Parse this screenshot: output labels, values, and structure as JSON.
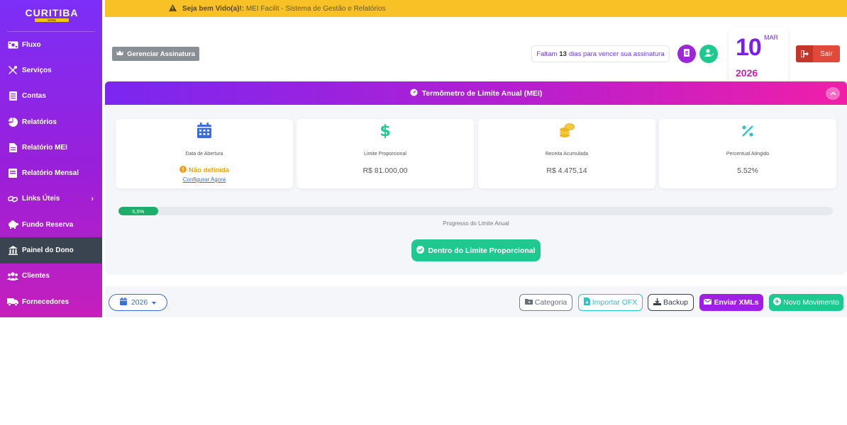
{
  "sidebar": {
    "logo_text": "CURITIBA",
    "logo_subtext": "SITES",
    "items": [
      {
        "label": "Fluxo",
        "icon": "money-bill-icon"
      },
      {
        "label": "Serviços",
        "icon": "tools-icon"
      },
      {
        "label": "Contas",
        "icon": "document-icon"
      },
      {
        "label": "Relatórios",
        "icon": "pie-chart-icon"
      },
      {
        "label": "Relatório MEI",
        "icon": "file-icon"
      },
      {
        "label": "Relatório Mensal",
        "icon": "book-icon"
      },
      {
        "label": "Links Úteis",
        "icon": "link-icon"
      },
      {
        "label": "Fundo Reserva",
        "icon": "piggy-bank-icon"
      },
      {
        "label": "Painel do Dono",
        "icon": "bank-icon"
      },
      {
        "label": "Clientes",
        "icon": "users-icon"
      },
      {
        "label": "Fornecedores",
        "icon": "truck-icon"
      }
    ],
    "active_item": "Painel do Dono"
  },
  "topbar": {
    "greeting": "Seja bem Vido(a)!:",
    "message": "MEI Facilit - Sistema de Gestão e Relatórios"
  },
  "header": {
    "gerenciar_label": "Gerenciar Assinatura",
    "faltam_prefix": "Faltam",
    "faltam_days": "13",
    "faltam_suffix": "dias para vencer sua assinatura",
    "date_day": "10",
    "date_month": "MAR",
    "date_year": "2026",
    "sair_label": "Sair"
  },
  "thermometer": {
    "title": "Termômetro de Limite Anual (MEI)",
    "cards": {
      "abertura": {
        "label": "Data de Abertura",
        "status": "Não definida",
        "link": "Configurar Agora"
      },
      "limite": {
        "label": "Limite Proporcional",
        "value": "R$ 81.000,00"
      },
      "receita": {
        "label": "Receita Acumulada",
        "value": "R$ 4.475,14"
      },
      "percentual": {
        "label": "Percentual Atingido",
        "value": "5.52%"
      }
    },
    "progress_label": "5,5%",
    "progress_value": 5.52,
    "progress_caption": "Progresso do Limite Anual",
    "status_label": "Dentro do Limite Proporcional"
  },
  "toolbar": {
    "year": "2026",
    "categoria": "Categoria",
    "importar_ofx": "Importar OFX",
    "backup": "Backup",
    "enviar_xmls": "Enviar XMLs",
    "novo_movimento": "Novo Movimento"
  },
  "colors": {
    "sidebar_gradient_top": "#7b2ff7",
    "sidebar_gradient_bottom": "#c61fbc",
    "alert_yellow": "#f8c226",
    "success_green": "#1ec98f",
    "danger_red": "#e1493b",
    "accent_purple": "#7a1ff0",
    "accent_pink": "#d11ea6"
  }
}
